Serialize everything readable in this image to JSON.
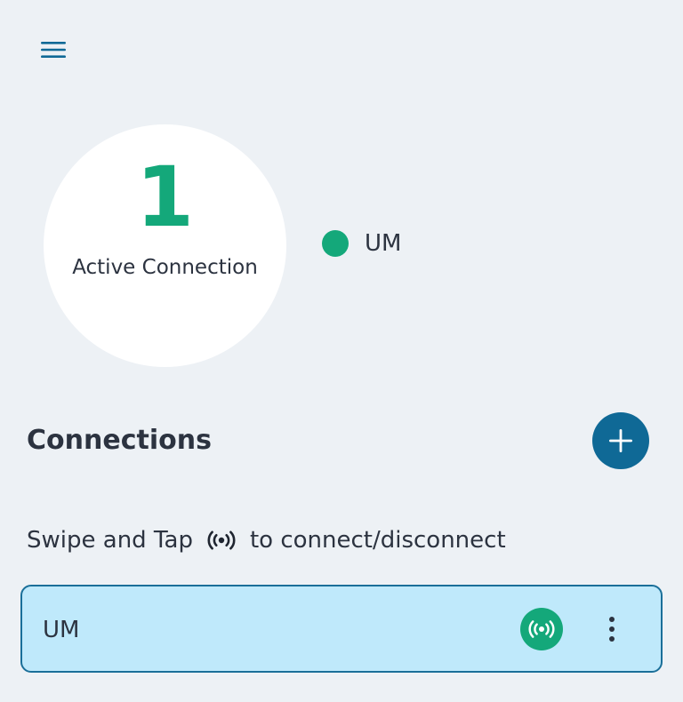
{
  "colors": {
    "background": "#edf1f5",
    "accent_blue": "#0f6996",
    "active_green": "#14a87a",
    "card_fill": "#bfe9fb",
    "card_border": "#1a6f99",
    "text": "#2c3340"
  },
  "header": {
    "menu_icon": "hamburger-menu-icon"
  },
  "status": {
    "active_count": "1",
    "active_label": "Active Connection"
  },
  "legend": {
    "items": [
      {
        "label": "UM",
        "color": "#14a87a"
      }
    ]
  },
  "connections_section": {
    "title": "Connections",
    "add_icon": "plus-icon"
  },
  "hint": {
    "before": "Swipe and Tap",
    "icon": "broadcast-icon",
    "after": "to connect/disconnect"
  },
  "connections": [
    {
      "name": "UM",
      "status": "connected",
      "toggle_icon": "broadcast-icon",
      "more_icon": "more-vertical-icon"
    }
  ]
}
